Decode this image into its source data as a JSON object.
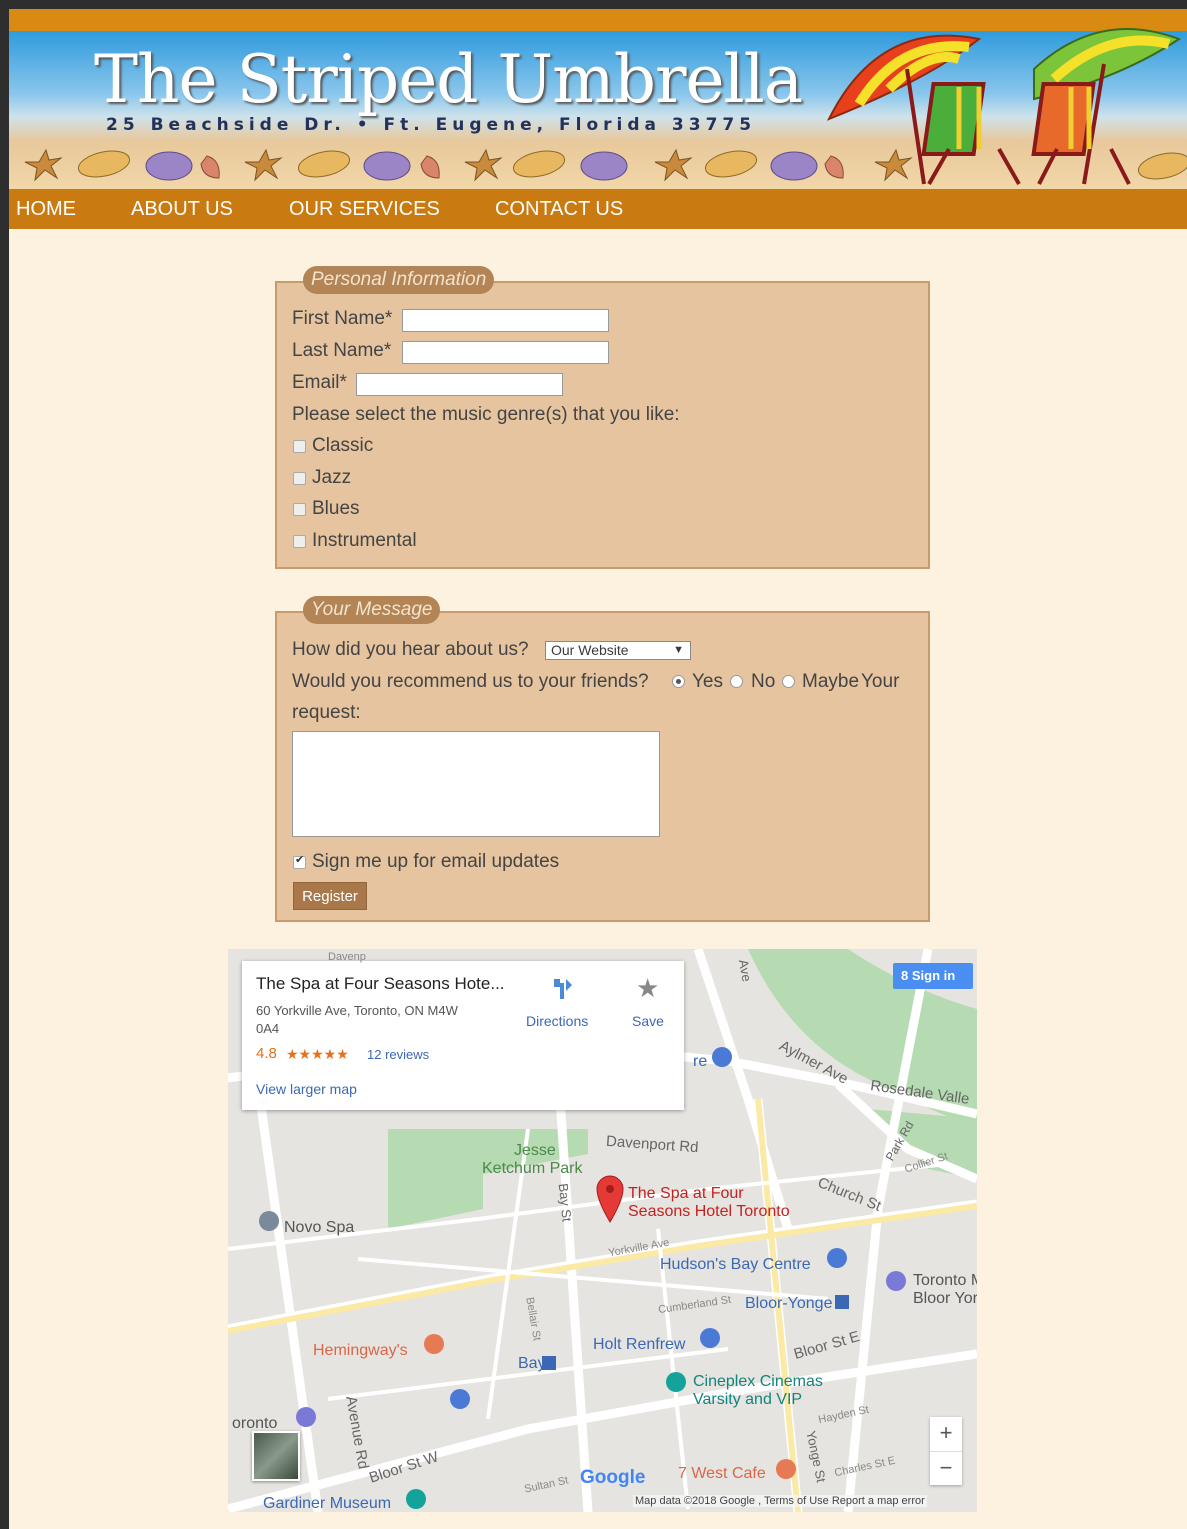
{
  "header": {
    "title": "The Striped Umbrella",
    "address": "25 Beachside Dr. • Ft. Eugene, Florida 33775"
  },
  "nav": [
    "HOME",
    "ABOUT US",
    "OUR SERVICES",
    "CONTACT US"
  ],
  "personal": {
    "legend": "Personal Information",
    "first_name_label": "First Name*",
    "first_name_value": "",
    "last_name_label": "Last Name*",
    "last_name_value": "",
    "email_label": "Email*",
    "email_value": "",
    "genre_prompt": "Please select the music genre(s) that you like:",
    "genres": [
      {
        "label": "Classic",
        "checked": false
      },
      {
        "label": "Jazz",
        "checked": false
      },
      {
        "label": "Blues",
        "checked": false
      },
      {
        "label": "Instrumental",
        "checked": false
      }
    ]
  },
  "message": {
    "legend": "Your Message",
    "hear_label": "How did you hear about us?",
    "hear_selected": "Our Website",
    "recommend_label": "Would you recommend us to your friends?",
    "options": [
      {
        "label": "Yes",
        "checked": true
      },
      {
        "label": "No",
        "checked": false
      },
      {
        "label": "Maybe",
        "checked": false
      }
    ],
    "request_label_1": "Your",
    "request_label_2": "request:",
    "request_value": "",
    "signup_label": "Sign me up for email updates",
    "signup_checked": true,
    "register_label": "Register"
  },
  "map": {
    "place_name": "The Spa at Four Seasons Hote...",
    "address_line1": "60 Yorkville Ave, Toronto, ON M4W",
    "address_line2": "0A4",
    "rating": "4.8",
    "stars": "★★★★★",
    "reviews": "12 reviews",
    "larger_map": "View larger map",
    "directions": "Directions",
    "save": "Save",
    "sign_in": "Sign in",
    "pin_label_1": "The Spa at Four",
    "pin_label_2": "Seasons Hotel Toronto",
    "places": [
      {
        "name": "Jesse",
        "color": "#4a8a4a"
      },
      {
        "name": "Ketchum Park",
        "color": "#4a8a4a"
      },
      {
        "name": "Novo Spa",
        "color": "#555555"
      },
      {
        "name": "Hudson's Bay Centre",
        "color": "#3b68b5"
      },
      {
        "name": "Bloor-Yonge",
        "color": "#3b68b5"
      },
      {
        "name": "Toronto M",
        "color": "#555555"
      },
      {
        "name": "Bloor Yor",
        "color": "#555555"
      },
      {
        "name": "Hemingway's",
        "color": "#d9674a"
      },
      {
        "name": "Holt Renfrew",
        "color": "#3b68b5"
      },
      {
        "name": "Bay",
        "color": "#3b68b5"
      },
      {
        "name": "Cineplex Cinemas",
        "color": "#13847d"
      },
      {
        "name": "Varsity and VIP",
        "color": "#13847d"
      },
      {
        "name": "7 West Cafe",
        "color": "#d9674a"
      },
      {
        "name": "Gardiner Museum",
        "color": "#3b68b5"
      },
      {
        "name": "oronto",
        "color": "#555555"
      },
      {
        "name": "re",
        "color": "#3b68b5"
      }
    ],
    "streets": [
      "Davenport Rd",
      "Aylmer Ave",
      "Rosedale Valle",
      "Church St",
      "Park Rd",
      "Collier St",
      "Bay St",
      "Yorkville Ave",
      "Cumberland St",
      "Bloor St E",
      "Bloor St W",
      "Bellair St",
      "Avenue Rd",
      "Hayden St",
      "Charles St E",
      "Sultan St",
      "Yonge St",
      "Ave",
      "Davenp"
    ],
    "footer": "Map data ©2018 Google , Terms of Use  Report a map error",
    "google": "Google"
  }
}
